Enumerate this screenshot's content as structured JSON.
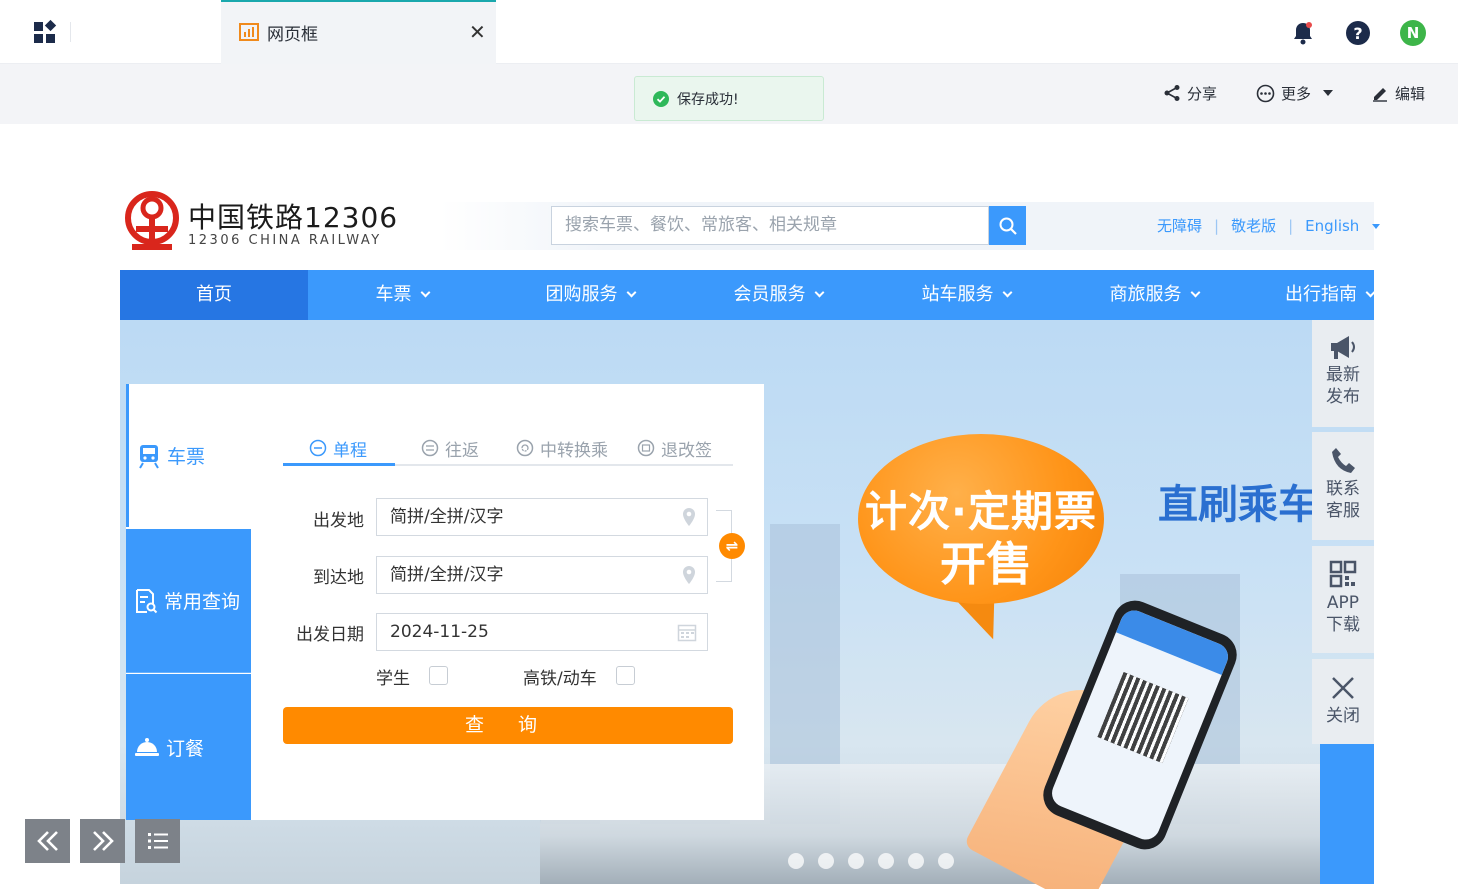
{
  "app": {
    "tab": {
      "label": "网页框"
    },
    "toast": {
      "message": "保存成功!"
    },
    "toolbar": {
      "share": "分享",
      "more": "更多",
      "edit": "编辑"
    },
    "user_avatar": "N"
  },
  "site": {
    "logo": {
      "title": "中国铁路12306",
      "subtitle": "12306 CHINA RAILWAY"
    },
    "search": {
      "placeholder": "搜索车票、餐饮、常旅客、相关规章"
    },
    "top_links": [
      "无障碍",
      "敬老版",
      "English"
    ],
    "nav": [
      {
        "label": "首页",
        "active": true
      },
      {
        "label": "车票"
      },
      {
        "label": "团购服务"
      },
      {
        "label": "会员服务"
      },
      {
        "label": "站车服务"
      },
      {
        "label": "商旅服务"
      },
      {
        "label": "出行指南"
      }
    ],
    "booking": {
      "side_tabs": [
        "车票",
        "常用查询",
        "订餐"
      ],
      "trip_tabs": [
        "单程",
        "往返",
        "中转换乘",
        "退改签"
      ],
      "from_label": "出发地",
      "from_value": "简拼/全拼/汉字",
      "to_label": "到达地",
      "to_value": "简拼/全拼/汉字",
      "date_label": "出发日期",
      "date_value": "2024-11-25",
      "student_label": "学生",
      "highspeed_label": "高铁/动车",
      "query_button": "查 询"
    },
    "banner": {
      "bubble_line1": "计次·定期票",
      "bubble_line2": "开售",
      "slogan": "直刷乘车",
      "dot_count": 6
    },
    "side_bar": [
      {
        "line1": "最新",
        "line2": "发布"
      },
      {
        "line1": "联系",
        "line2": "客服"
      },
      {
        "line1": "APP",
        "line2": "下载"
      },
      {
        "line1": "关闭",
        "line2": ""
      }
    ]
  },
  "colors": {
    "brand_blue": "#3b99fc",
    "accent_orange": "#ff8a00",
    "tab_accent": "#1aa8ad"
  }
}
